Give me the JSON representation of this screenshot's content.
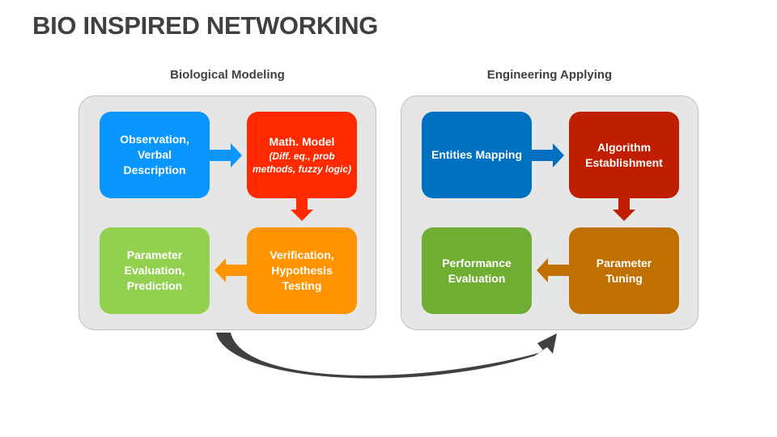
{
  "title": "BIO INSPIRED NETWORKING",
  "sections": [
    {
      "label": "Biological Modeling",
      "nodes": [
        {
          "lines": [
            "Observation,",
            "Verbal",
            "Description"
          ],
          "subtitle": [],
          "color": "#0a96ff"
        },
        {
          "lines": [
            "Math. Model"
          ],
          "subtitle": [
            "(Diff. eq., prob",
            "methods, fuzzy logic)"
          ],
          "color": "#ff2a00"
        },
        {
          "lines": [
            "Verification,",
            "Hypothesis",
            "Testing"
          ],
          "subtitle": [],
          "color": "#ff9400"
        },
        {
          "lines": [
            "Parameter",
            "Evaluation,",
            "Prediction"
          ],
          "subtitle": [],
          "color": "#92d050"
        }
      ]
    },
    {
      "label": "Engineering Applying",
      "nodes": [
        {
          "lines": [
            "Entities Mapping"
          ],
          "subtitle": [],
          "color": "#0070c0"
        },
        {
          "lines": [
            "Algorithm",
            "Establishment"
          ],
          "subtitle": [],
          "color": "#c01e00"
        },
        {
          "lines": [
            "Parameter",
            "Tuning"
          ],
          "subtitle": [],
          "color": "#c07000"
        },
        {
          "lines": [
            "Performance",
            "Evaluation"
          ],
          "subtitle": [],
          "color": "#70ad33"
        }
      ]
    }
  ],
  "connector_color": "#404040",
  "panel_color": "#e6e6e6"
}
